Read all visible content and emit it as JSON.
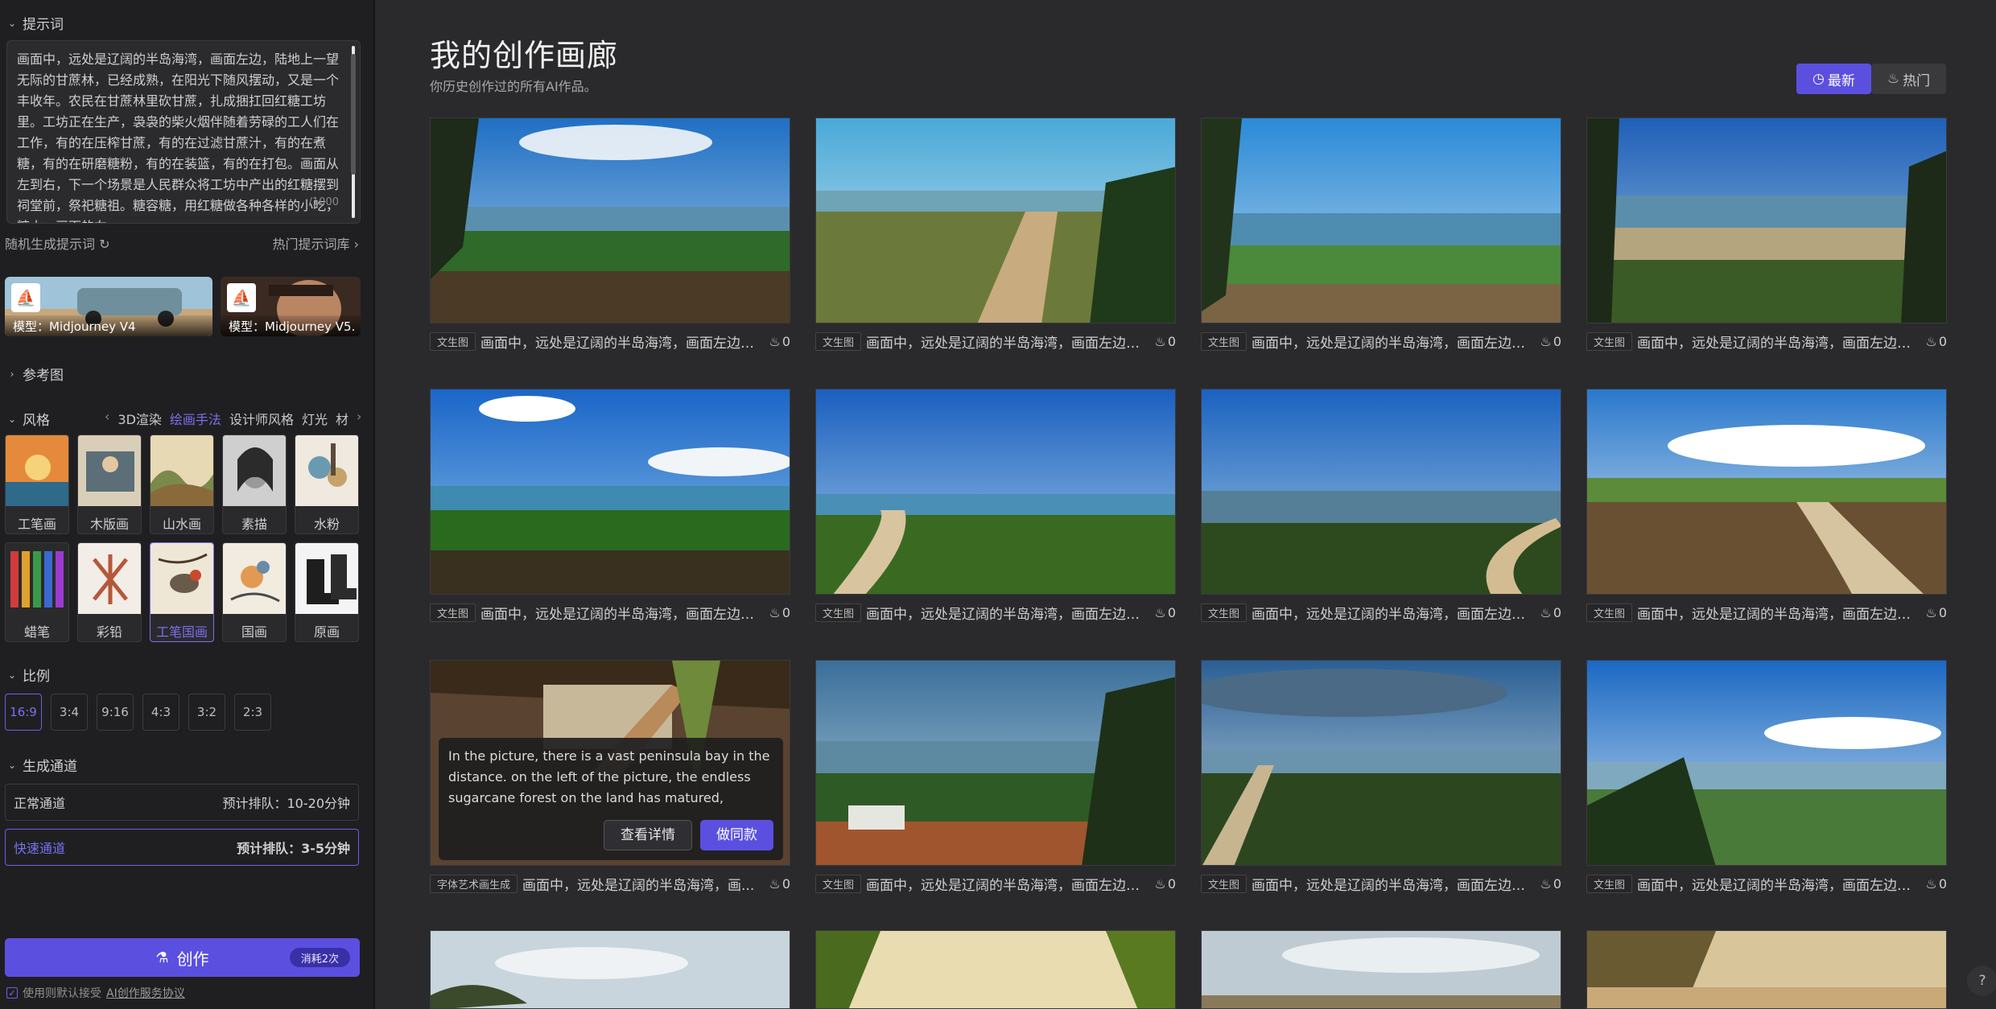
{
  "sidebar": {
    "prompt_header": "提示词",
    "prompt_text": "画面中，远处是辽阔的半岛海湾，画面左边，陆地上一望无际的甘蔗林，已经成熟，在阳光下随风摆动，又是一个丰收年。农民在甘蔗林里砍甘蔗，扎成捆扛回红糖工坊里。工坊正在生产，袅袅的柴火烟伴随着劳碌的工人们在工作，有的在压榨甘蔗，有的在过滤甘蔗汁，有的在煮糖，有的在研磨糖粉，有的在装篮，有的在打包。画面从左到右，下一个场景是人民群众将工坊中产出的红糖摆到祠堂前，祭祀糖祖。糖容糖，用红糖做各种各样的小吃，糖水，画面的右",
    "prompt_counter": "/1000",
    "random_link": "随机生成提示词",
    "hot_link": "热门提示词库",
    "models": [
      {
        "label": "模型：Midjourney V4"
      },
      {
        "label": "模型：Midjourney V5."
      }
    ],
    "reference_header": "参考图",
    "style_header": "风格",
    "style_tabs": [
      "3D渲染",
      "绘画手法",
      "设计师风格",
      "灯光",
      "材"
    ],
    "style_items": [
      "工笔画",
      "木版画",
      "山水画",
      "素描",
      "水粉",
      "蜡笔",
      "彩铅",
      "工笔国画",
      "国画",
      "原画"
    ],
    "selected_style": "工笔国画",
    "ratio_header": "比例",
    "ratios": [
      "16:9",
      "3:4",
      "9:16",
      "4:3",
      "3:2",
      "2:3"
    ],
    "selected_ratio": "16:9",
    "channel_header": "生成通道",
    "channels": [
      {
        "name": "正常通道",
        "queue": "预计排队：10-20分钟"
      },
      {
        "name": "快速通道",
        "queue": "预计排队：3-5分钟"
      }
    ],
    "create_label": "创作",
    "create_cost": "消耗2次",
    "agree_text": "使用则默认接受",
    "agree_link": "AI创作服务协议"
  },
  "main": {
    "title": "我的创作画廊",
    "subtitle": "你历史创作过的所有AI作品。",
    "sort_latest": "最新",
    "sort_hot": "热门",
    "hover": {
      "text": "In the picture, there is a vast peninsula bay in the distance. on the left of the picture, the endless sugarcane forest on the land has matured, swaying with the wind i...",
      "detail_button": "查看详情",
      "same_button": "做同款"
    },
    "cards": [
      {
        "tag": "文生图",
        "desc": "画面中，远处是辽阔的半岛海湾，画面左边，...",
        "likes": "0"
      },
      {
        "tag": "文生图",
        "desc": "画面中，远处是辽阔的半岛海湾，画面左边，...",
        "likes": "0"
      },
      {
        "tag": "文生图",
        "desc": "画面中，远处是辽阔的半岛海湾，画面左边，...",
        "likes": "0"
      },
      {
        "tag": "文生图",
        "desc": "画面中，远处是辽阔的半岛海湾，画面左边，...",
        "likes": "0"
      },
      {
        "tag": "文生图",
        "desc": "画面中，远处是辽阔的半岛海湾，画面左边，...",
        "likes": "0"
      },
      {
        "tag": "文生图",
        "desc": "画面中，远处是辽阔的半岛海湾，画面左边，...",
        "likes": "0"
      },
      {
        "tag": "文生图",
        "desc": "画面中，远处是辽阔的半岛海湾，画面左边，...",
        "likes": "0"
      },
      {
        "tag": "文生图",
        "desc": "画面中，远处是辽阔的半岛海湾，画面左边，...",
        "likes": "0"
      },
      {
        "tag": "字体艺术画生成",
        "desc": "画面中，远处是辽阔的半岛海湾，画...",
        "likes": "0"
      },
      {
        "tag": "文生图",
        "desc": "画面中，远处是辽阔的半岛海湾，画面左边，...",
        "likes": "0"
      },
      {
        "tag": "文生图",
        "desc": "画面中，远处是辽阔的半岛海湾，画面左边，...",
        "likes": "0"
      },
      {
        "tag": "文生图",
        "desc": "画面中，远处是辽阔的半岛海湾，画面左边，...",
        "likes": "0"
      }
    ],
    "help": "?"
  },
  "colors": {
    "accent": "#5b4fe0",
    "accent_text": "#7b6ff0",
    "bg": "#2a2a2c",
    "sidebar_bg": "#1f1f21"
  }
}
